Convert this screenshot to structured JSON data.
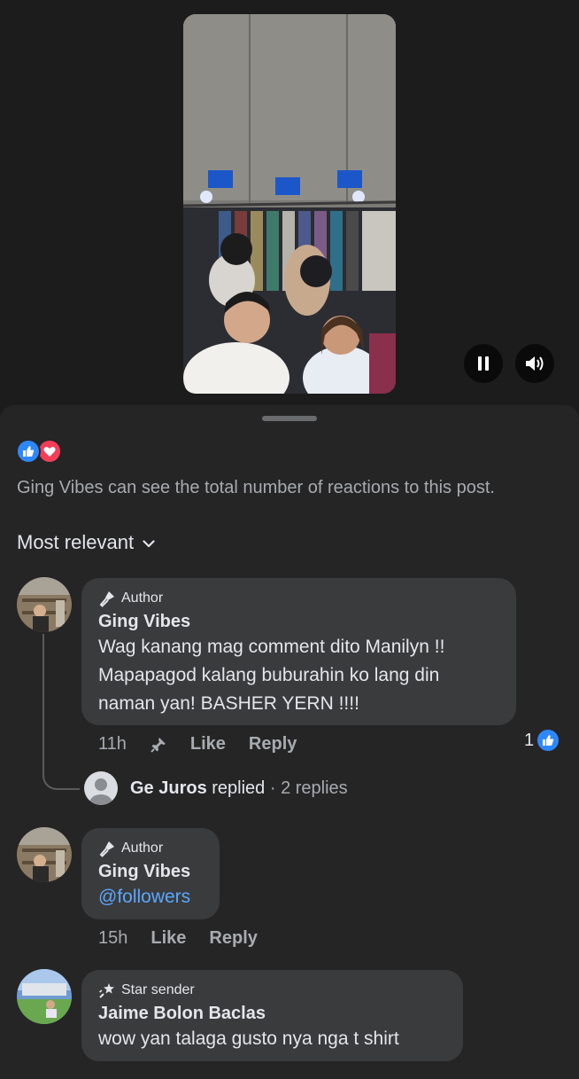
{
  "video": {
    "controls": {
      "pause_icon": "pause-icon",
      "volume_icon": "volume-icon"
    }
  },
  "reactions": {
    "icons": [
      "like-icon",
      "love-icon"
    ],
    "note": "Ging Vibes can see the total number of reactions to this post."
  },
  "sort": {
    "label": "Most relevant"
  },
  "comments": [
    {
      "badge": "Author",
      "badge_icon": "microphone-icon",
      "author": "Ging Vibes",
      "lines": [
        "Wag kanang mag comment dito Manilyn !!",
        "Mapapagod kalang buburahin ko lang din",
        "naman yan! BASHER YERN !!!!"
      ],
      "time": "11h",
      "pinned": true,
      "like_label": "Like",
      "reply_label": "Reply",
      "like_count": "1",
      "replies": {
        "name": "Ge Juros",
        "verb": "replied",
        "count_text": " · 2 replies"
      }
    },
    {
      "badge": "Author",
      "badge_icon": "microphone-icon",
      "author": "Ging Vibes",
      "mention": "@followers",
      "time": "15h",
      "like_label": "Like",
      "reply_label": "Reply"
    },
    {
      "badge": "Star sender",
      "badge_icon": "star-sender-icon",
      "author": "Jaime Bolon Baclas",
      "text": "wow yan talaga gusto nya nga t shirt"
    }
  ],
  "colors": {
    "background": "#1c1c1d",
    "sheet": "#252526",
    "bubble": "#3a3b3c",
    "like_blue": "#2d88ff",
    "love_red": "#f33e58",
    "mention": "#5aa7ff"
  }
}
